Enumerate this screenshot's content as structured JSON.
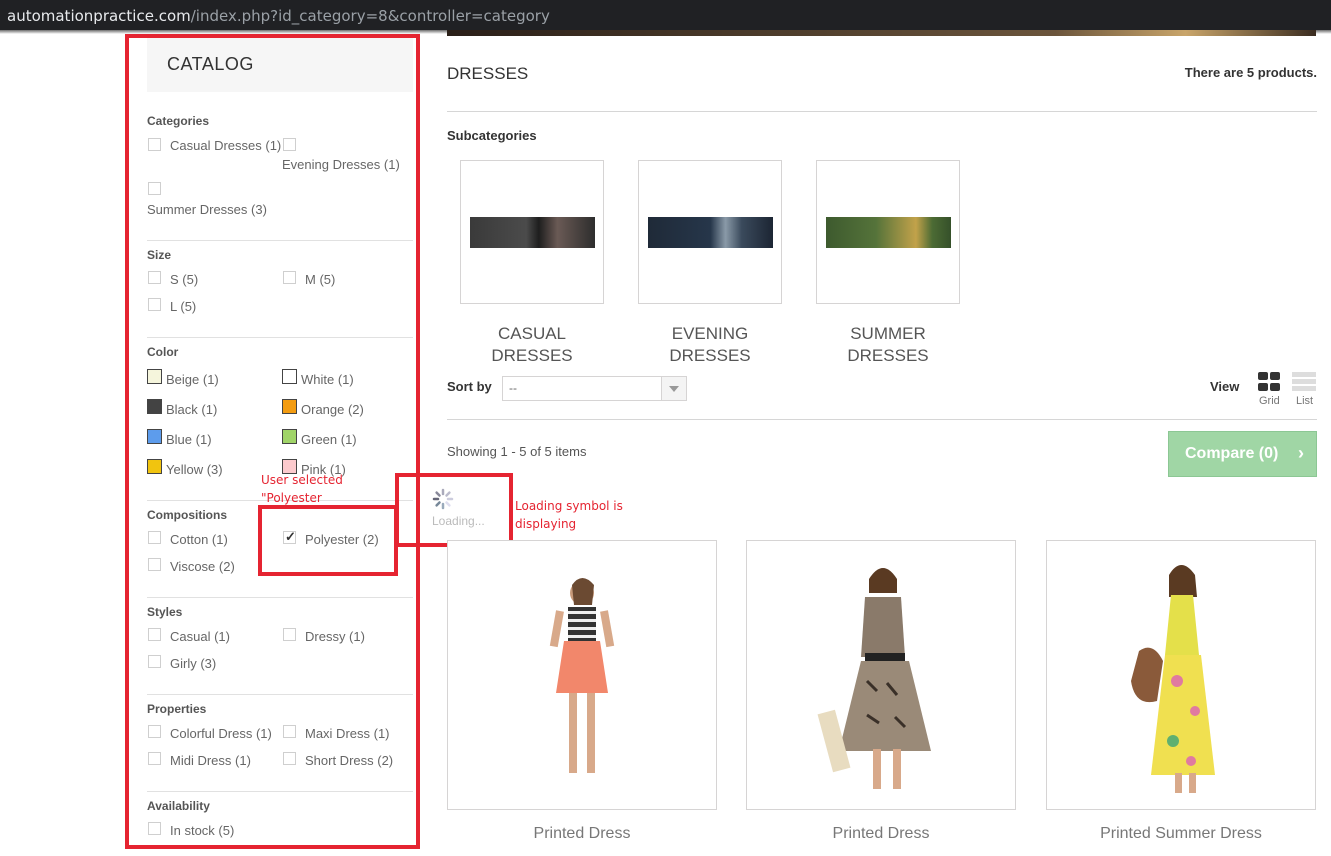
{
  "browser": {
    "url_host": "automationpractice.com",
    "url_path": "/index.php?id_category=8&controller=category"
  },
  "sidebar": {
    "title": "CATALOG",
    "sections": {
      "categories": {
        "title": "Categories",
        "items": [
          "Casual Dresses (1)",
          "Evening Dresses (1)",
          "Summer Dresses (3)"
        ]
      },
      "size": {
        "title": "Size",
        "items": [
          "S (5)",
          "M (5)",
          "L (5)"
        ]
      },
      "color": {
        "title": "Color",
        "items": [
          {
            "label": "Beige (1)",
            "color": "#f5f5dc"
          },
          {
            "label": "White (1)",
            "color": "#ffffff"
          },
          {
            "label": "Black (1)",
            "color": "#434343"
          },
          {
            "label": "Orange (2)",
            "color": "#f39c11"
          },
          {
            "label": "Blue (1)",
            "color": "#5d9cec"
          },
          {
            "label": "Green (1)",
            "color": "#a0d468"
          },
          {
            "label": "Yellow (3)",
            "color": "#f1c40f"
          },
          {
            "label": "Pink (1)",
            "color": "#fccacd"
          }
        ]
      },
      "compositions": {
        "title": "Compositions",
        "items": [
          {
            "label": "Cotton (1)",
            "checked": false
          },
          {
            "label": "Polyester (2)",
            "checked": true
          },
          {
            "label": "Viscose (2)",
            "checked": false
          }
        ]
      },
      "styles": {
        "title": "Styles",
        "items": [
          "Casual (1)",
          "Dressy (1)",
          "Girly (3)"
        ]
      },
      "properties": {
        "title": "Properties",
        "items": [
          "Colorful Dress (1)",
          "Maxi Dress (1)",
          "Midi Dress (1)",
          "Short Dress (2)"
        ]
      },
      "availability": {
        "title": "Availability",
        "items": [
          "In stock (5)"
        ]
      }
    }
  },
  "annotations": {
    "user_selected": "User selected \"Polyester",
    "loading_note": "Loading symbol is displaying"
  },
  "main": {
    "title": "DRESSES",
    "product_count": "There are 5 products.",
    "subcategories_title": "Subcategories",
    "subcategories": [
      {
        "line1": "CASUAL",
        "line2": "DRESSES"
      },
      {
        "line1": "EVENING",
        "line2": "DRESSES"
      },
      {
        "line1": "SUMMER",
        "line2": "DRESSES"
      }
    ],
    "sort_label": "Sort by",
    "sort_value": "--",
    "view_label": "View",
    "view_grid": "Grid",
    "view_list": "List",
    "showing": "Showing 1 - 5 of 5 items",
    "compare_label": "Compare (0)",
    "loading_text": "Loading...",
    "products": [
      {
        "name": "Printed Dress"
      },
      {
        "name": "Printed Dress"
      },
      {
        "name": "Printed Summer Dress"
      }
    ]
  }
}
